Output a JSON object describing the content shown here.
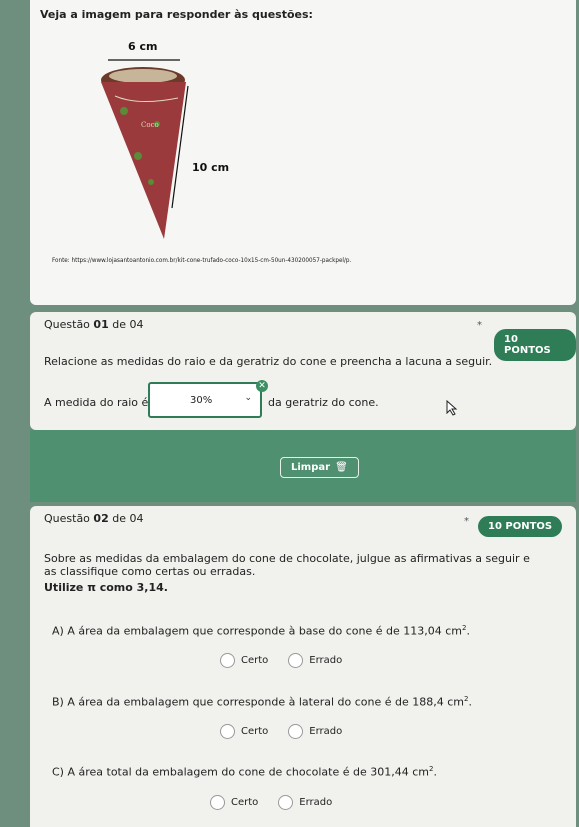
{
  "intro": {
    "heading": "Veja a imagem para responder às questões:",
    "dim_top": "6 cm",
    "dim_side": "10 cm",
    "source": "Fonte: https://www.lojasantoantonio.com.br/kit-cone-trufado-coco-10x15-cm-50un-430200057-packpel/p."
  },
  "q1": {
    "label_prefix": "Questão",
    "number": "01",
    "of": "de 04",
    "required_mark": "*",
    "points": "10 PONTOS",
    "statement": "Relacione as medidas do raio e da geratriz do cone e preencha a lacuna a seguir.",
    "before": "A medida do raio é",
    "selected": "30%",
    "after": "da geratriz do cone.",
    "clear_label": "Limpar"
  },
  "q2": {
    "label_prefix": "Questão",
    "number": "02",
    "of": "de 04",
    "required_mark": "*",
    "points": "10 PONTOS",
    "statement": "Sobre as medidas da embalagem do cone de chocolate, julgue as afirmativas a seguir e as classifique como certas ou erradas.",
    "pi_note": "Utilize π como 3,14.",
    "a": "A) A área da embalagem que corresponde à base do cone é de 113,04 cm",
    "b": "B) A área da embalagem que corresponde à lateral do cone é de 188,4 cm",
    "c": "C) A área total da embalagem do cone de chocolate é de 301,44 cm",
    "exp": "2",
    "dot": ".",
    "opt_true": "Certo",
    "opt_false": "Errado"
  }
}
